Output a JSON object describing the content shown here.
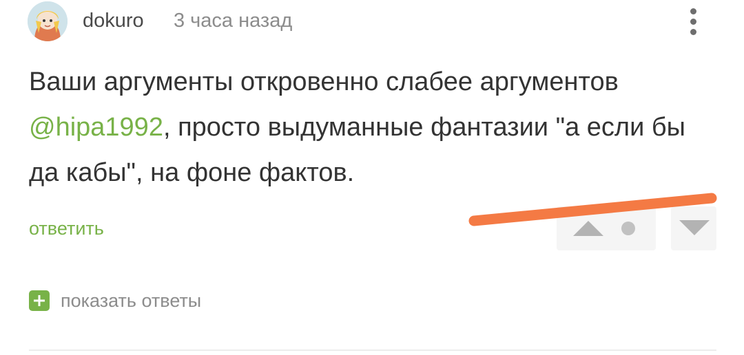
{
  "comment": {
    "author": "dokuro",
    "time": "3 часа назад",
    "text_before_mention": "Ваши аргументы откровенно слабее аргументов ",
    "mention": "@hipa1992",
    "text_after_mention": ", просто выдуманные фантазии \"а если бы да кабы\", на фоне фактов."
  },
  "actions": {
    "reply_label": "ответить",
    "show_replies_label": "показать ответы"
  },
  "icons": {
    "menu": "more-vertical-icon",
    "upvote": "triangle-up-icon",
    "rating": "dot-icon",
    "downvote": "triangle-down-icon",
    "expand": "plus-icon"
  },
  "colors": {
    "accent": "#78b248",
    "text": "#333333",
    "muted": "#8c8c8c",
    "annotation_stroke": "#f47a44"
  }
}
